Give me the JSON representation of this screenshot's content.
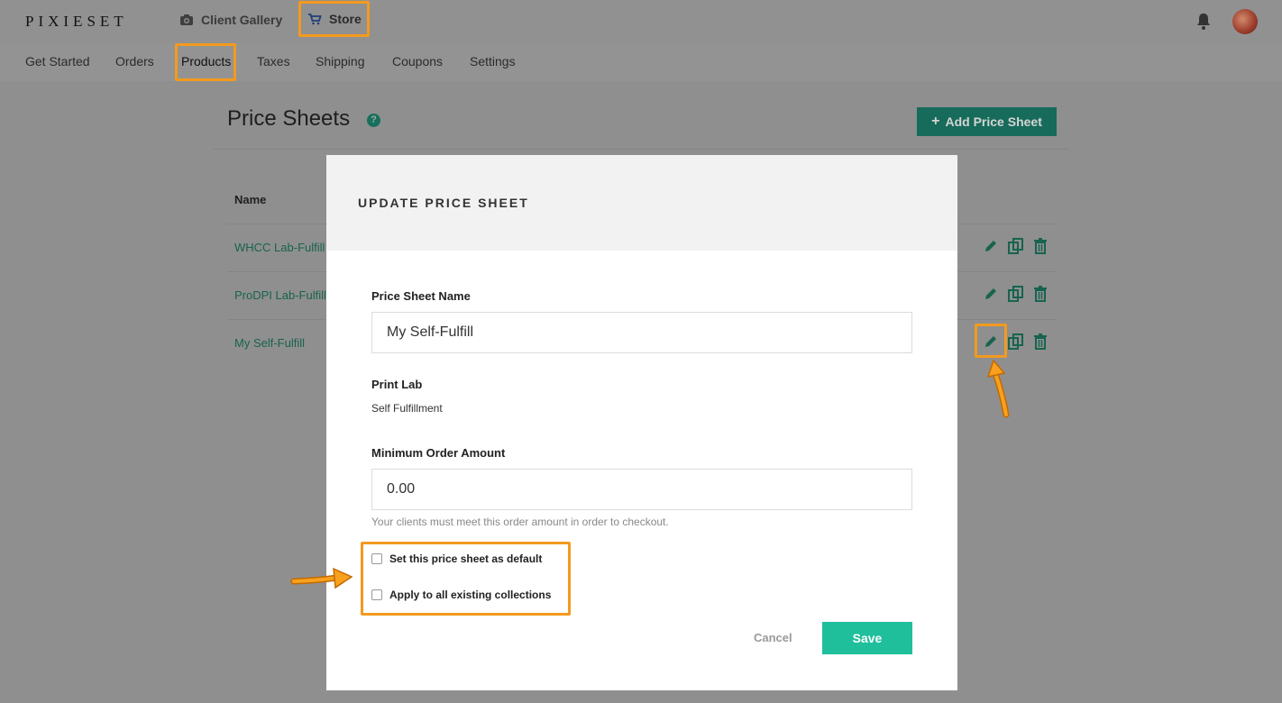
{
  "brand": {
    "logo": "PIXIESET"
  },
  "top_nav": {
    "client_gallery": "Client Gallery",
    "store": "Store"
  },
  "sub_nav": [
    "Get Started",
    "Orders",
    "Products",
    "Taxes",
    "Shipping",
    "Coupons",
    "Settings"
  ],
  "page": {
    "title": "Price Sheets",
    "help_glyph": "?",
    "add_button": "Add Price Sheet"
  },
  "table": {
    "column_name": "Name",
    "rows": [
      "WHCC Lab-Fulfill",
      "ProDPI Lab-Fulfill",
      "My Self-Fulfill"
    ]
  },
  "modal": {
    "title": "UPDATE PRICE SHEET",
    "name_label": "Price Sheet Name",
    "name_value": "My Self-Fulfill",
    "print_lab_label": "Print Lab",
    "print_lab_value": "Self Fulfillment",
    "min_order_label": "Minimum Order Amount",
    "min_order_value": "0.00",
    "min_order_help": "Your clients must meet this order amount in order to checkout.",
    "checkbox_default": "Set this price sheet as default",
    "checkbox_default_checked": false,
    "checkbox_apply": "Apply to all existing collections",
    "checkbox_apply_checked": false,
    "cancel": "Cancel",
    "save": "Save"
  },
  "icons": {
    "camera": "camera-icon",
    "cart": "cart-icon",
    "bell": "bell-icon",
    "edit": "pencil-icon",
    "duplicate": "copy-icon",
    "delete": "trash-icon"
  },
  "colors": {
    "accent": "#1fbf9c",
    "highlight": "#f39a1e",
    "link": "#1fbf9c"
  }
}
